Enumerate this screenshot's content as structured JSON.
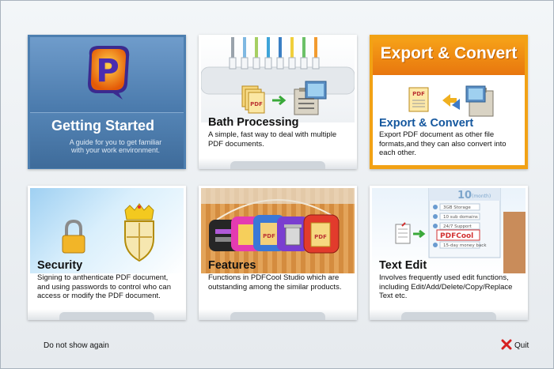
{
  "cards": [
    {
      "title": "Getting Started",
      "description": "A guide for you to get familiar with your work environment."
    },
    {
      "title": "Bath Processing",
      "description": "A simple, fast way to deal with multiple PDF documents."
    },
    {
      "title": "Export & Convert",
      "banner": "Export & Convert",
      "description": "Export PDF document as other file formats,and they can also convert into each other."
    },
    {
      "title": "Security",
      "description": "Signing to anthenticate PDF document, and using passwords to control who can access or modify the PDF document."
    },
    {
      "title": "Features",
      "description": "Functions in PDFCool Studio which are outstanding among the similar products."
    },
    {
      "title": "Text Edit",
      "description": "Involves frequently used edit functions, including Edit/Add/Delete/Copy/Replace Text etc."
    }
  ],
  "icon_labels": {
    "pdf": "PDF",
    "pdfcool": "PDFCool"
  },
  "text_edit_list": [
    "10",
    "(month)",
    "3GB Storage",
    "10 sub domains",
    "24/7 Support",
    "15-day money back"
  ],
  "footer": {
    "dont_show": "Do not show again",
    "quit": "Quit"
  },
  "colors": {
    "accent_blue": "#14579e",
    "export_orange": "#f2a215",
    "quit_red": "#d62020"
  }
}
